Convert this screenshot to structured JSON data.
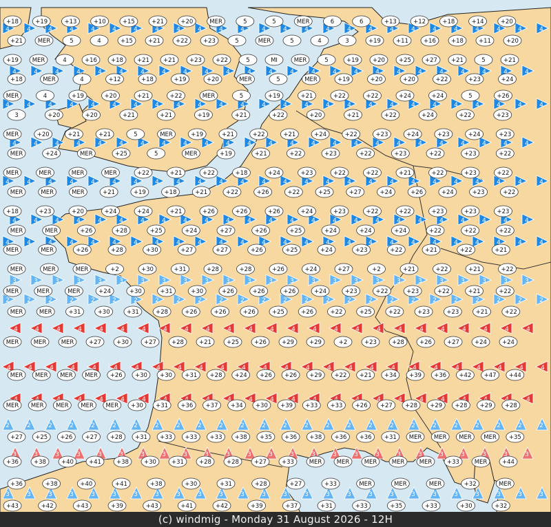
{
  "credit": "(c) windmig - Monday 31 August 2026 - 12H",
  "colors": {
    "sea": "#d6e9f3",
    "land": "#f8d8a1",
    "border": "#222222",
    "wind_dark_blue": "#1565c0",
    "wind_blue": "#1e88e5",
    "wind_light_blue": "#64b5f6",
    "wind_red": "#e53935",
    "wind_light_red": "#ef6f6f"
  },
  "sea_marker_label": "MER",
  "rows": [
    {
      "rowY": 20,
      "items": [
        "+18",
        "+19",
        "+13",
        "+10",
        "+15",
        "+21",
        "+20",
        "MER",
        "5",
        "5",
        "MER",
        "6",
        "6",
        "+13",
        "+12",
        "+18",
        "+14",
        "+20"
      ]
    },
    {
      "rowY": 48,
      "items": [
        "+21",
        "MER",
        "5",
        "4",
        "+15",
        "+21",
        "+22",
        "+23",
        "5",
        "MER",
        "5",
        "4",
        "3",
        "+19",
        "+11",
        "+16",
        "+18",
        "+11",
        "+20"
      ]
    },
    {
      "rowY": 76,
      "items": [
        "+19",
        "MER",
        "4",
        "+16",
        "+18",
        "+21",
        "+21",
        "+23",
        "+22",
        "5",
        "MI",
        "MER",
        "5",
        "+19",
        "+20",
        "+25",
        "+27",
        "+21",
        "5",
        "+21"
      ]
    },
    {
      "rowY": 104,
      "items": [
        "+18",
        "MER",
        "4",
        "+12",
        "+18",
        "+19",
        "+20",
        "MER",
        "5",
        "MER",
        "+19",
        "+20",
        "+20",
        "+22",
        "+23",
        "+24"
      ]
    },
    {
      "rowY": 128,
      "items": [
        "MER",
        "4",
        "+19",
        "+20",
        "+21",
        "+22",
        "MER",
        "5",
        "+19",
        "+21",
        "+22",
        "+22",
        "+24",
        "+24",
        "5",
        "+26"
      ]
    },
    {
      "rowY": 156,
      "items": [
        "3",
        "+20",
        "+20",
        "+21",
        "+21",
        "+19",
        "+21",
        "+22",
        "+20",
        "+21",
        "+22",
        "+24",
        "+22",
        "+23"
      ]
    },
    {
      "rowY": 184,
      "items": [
        "MER",
        "+20",
        "+21",
        "+21",
        "5",
        "MER",
        "+19",
        "+21",
        "+22",
        "+21",
        "+24",
        "+22",
        "+23",
        "+24",
        "+23",
        "+24",
        "+23"
      ]
    },
    {
      "rowY": 212,
      "items": [
        "MER",
        "+24",
        "MER",
        "+25",
        "5",
        "MER",
        "+19",
        "+21",
        "+22",
        "+23",
        "+22",
        "+23",
        "+22",
        "+23",
        "+22"
      ]
    },
    {
      "rowY": 240,
      "items": [
        "MER",
        "MER",
        "MER",
        "MER",
        "+22",
        "+21",
        "+22",
        "+18",
        "+24",
        "+23",
        "+22",
        "+22",
        "+21",
        "+22",
        "+23",
        "+22"
      ]
    },
    {
      "rowY": 268,
      "items": [
        "MER",
        "MER",
        "MER",
        "+21",
        "+19",
        "+18",
        "+21",
        "+22",
        "+26",
        "+22",
        "+25",
        "+27",
        "+24",
        "+26",
        "+24",
        "+23",
        "+22"
      ]
    },
    {
      "rowY": 296,
      "items": [
        "+18",
        "+23",
        "+20",
        "+24",
        "+24",
        "+21",
        "+26",
        "+26",
        "+26",
        "+24",
        "+23",
        "+22",
        "+22",
        "+23",
        "+23",
        "+23"
      ]
    },
    {
      "rowY": 324,
      "items": [
        "MER",
        "MER",
        "+26",
        "+28",
        "+25",
        "+24",
        "+27",
        "+26",
        "+25",
        "+24",
        "+24",
        "+24",
        "+22",
        "+22",
        "+22"
      ]
    },
    {
      "rowY": 352,
      "items": [
        "MER",
        "MER",
        "+26",
        "+28",
        "+30",
        "+27",
        "+27",
        "+26",
        "+25",
        "+24",
        "+23",
        "+22",
        "+21",
        "+22",
        "+21"
      ]
    },
    {
      "rowY": 380,
      "items": [
        "MER",
        "MER",
        "MER",
        "+2",
        "+30",
        "+31",
        "+28",
        "+28",
        "+26",
        "+24",
        "+27",
        "+2",
        "+21",
        "+22",
        "+21",
        "+22"
      ]
    },
    {
      "rowY": 412,
      "items": [
        "MER",
        "MER",
        "MER",
        "+24",
        "+30",
        "+31",
        "+30",
        "+26",
        "+26",
        "+26",
        "+24",
        "+23",
        "+22",
        "+23",
        "+22",
        "+21",
        "+22"
      ]
    },
    {
      "rowY": 442,
      "items": [
        "MER",
        "MER",
        "+31",
        "+30",
        "+31",
        "+28",
        "+26",
        "+26",
        "+26",
        "+25",
        "+26",
        "+22",
        "+25",
        "+22",
        "+23",
        "+23",
        "+21",
        "+22"
      ]
    },
    {
      "rowY": 486,
      "items": [
        "MER",
        "MER",
        "MER",
        "+27",
        "+30",
        "+27",
        "+28",
        "+21",
        "+25",
        "+26",
        "+29",
        "+29",
        "+2",
        "+23",
        "+28",
        "+26",
        "+27",
        "+24",
        "+24"
      ]
    },
    {
      "rowY": 534,
      "items": [
        "MER",
        "MER",
        "MER",
        "MER",
        "+26",
        "+30",
        "+30",
        "+31",
        "+28",
        "+24",
        "+26",
        "+26",
        "+29",
        "+22",
        "+21",
        "+34",
        "+39",
        "+36",
        "+42",
        "+47",
        "+44"
      ]
    },
    {
      "rowY": 578,
      "items": [
        "MER",
        "MER",
        "MER",
        "MER",
        "MER",
        "+30",
        "+31",
        "+36",
        "+37",
        "+34",
        "+30",
        "+39",
        "+33",
        "+33",
        "+26",
        "+27",
        "+28",
        "+29",
        "+28",
        "+29",
        "+28"
      ]
    },
    {
      "rowY": 624,
      "items": [
        "+27",
        "+25",
        "+26",
        "+27",
        "+28",
        "+31",
        "+33",
        "+33",
        "+33",
        "+38",
        "+35",
        "+36",
        "+38",
        "+36",
        "+36",
        "+31",
        "MER",
        "MER",
        "MER",
        "MER",
        "+35"
      ]
    },
    {
      "rowY": 660,
      "items": [
        "+36",
        "+38",
        "+40",
        "+41",
        "+38",
        "+30",
        "+31",
        "+28",
        "+28",
        "+27",
        "+33",
        "MER",
        "MER",
        "MER",
        "MER",
        "MER",
        "+33",
        "MER",
        "+44"
      ]
    },
    {
      "rowY": 692,
      "items": [
        "+36",
        "+38",
        "+40",
        "+41",
        "+38",
        "+30",
        "+31",
        "+28",
        "+27",
        "+33",
        "MER",
        "MER",
        "MER",
        "+32",
        "MER"
      ]
    },
    {
      "rowY": 724,
      "items": [
        "+43",
        "+42",
        "+43",
        "+39",
        "+43",
        "+41",
        "+42",
        "+39",
        "+37",
        "+31",
        "+33",
        "+35",
        "+33",
        "+30",
        "+32"
      ]
    }
  ],
  "arrow_rows": [
    {
      "rowY": 30,
      "dir": "e",
      "level": "4",
      "tone": "blue"
    },
    {
      "rowY": 92,
      "dir": "e",
      "level": "4",
      "tone": "blue"
    },
    {
      "rowY": 140,
      "dir": "e",
      "level": "4",
      "tone": "blue"
    },
    {
      "rowY": 196,
      "dir": "e",
      "level": "4",
      "tone": "blue"
    },
    {
      "rowY": 252,
      "dir": "e",
      "level": "4",
      "tone": "blue"
    },
    {
      "rowY": 308,
      "dir": "e",
      "level": "4",
      "tone": "blue"
    },
    {
      "rowY": 340,
      "dir": "e",
      "level": "4",
      "tone": "blue"
    },
    {
      "rowY": 396,
      "dir": "e",
      "level": "3",
      "tone": "lightblue"
    },
    {
      "rowY": 424,
      "dir": "e",
      "level": "2",
      "tone": "lightblue"
    },
    {
      "rowY": 466,
      "dir": "w",
      "level": "4",
      "tone": "red"
    },
    {
      "rowY": 522,
      "dir": "w",
      "level": "4",
      "tone": "red"
    },
    {
      "rowY": 568,
      "dir": "w",
      "level": "4",
      "tone": "red"
    },
    {
      "rowY": 606,
      "dir": "n",
      "level": "2",
      "tone": "lightblue"
    },
    {
      "rowY": 648,
      "dir": "n",
      "level": "3",
      "tone": "lightred"
    },
    {
      "rowY": 706,
      "dir": "n",
      "level": "3",
      "tone": "lightblue"
    }
  ]
}
